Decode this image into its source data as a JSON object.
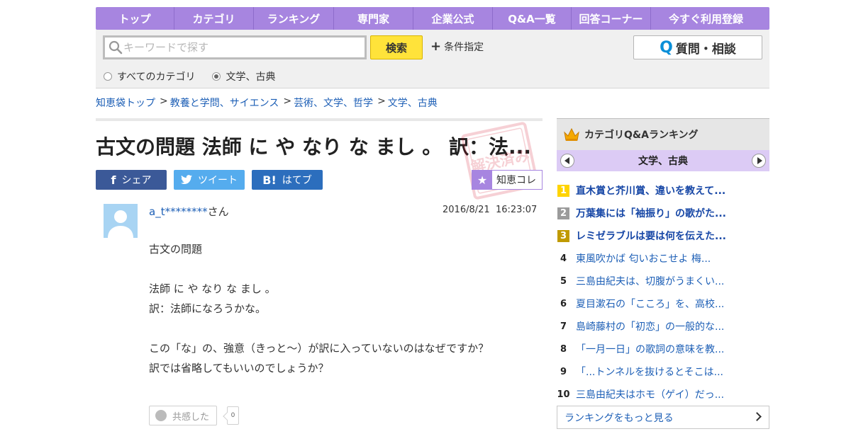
{
  "nav": {
    "items": [
      {
        "label": "トップ",
        "width": 111
      },
      {
        "label": "カテゴリ",
        "width": 112
      },
      {
        "label": "ランキング",
        "width": 113
      },
      {
        "label": "専門家",
        "width": 112
      },
      {
        "label": "企業公式",
        "width": 112
      },
      {
        "label": "Q&A一覧",
        "width": 111
      },
      {
        "label": "回答コーナー",
        "width": 112
      },
      {
        "label": "今すぐ利用登録",
        "width": 155
      }
    ]
  },
  "search": {
    "placeholder": "キーワードで探す",
    "button_label": "検索",
    "condition_label": "条件指定",
    "ask_label": "質問・相談",
    "ask_q": "Q",
    "radio_all": "すべてのカテゴリ",
    "radio_cat": "文学、古典",
    "selected": "radio_cat"
  },
  "breadcrumb": {
    "items": [
      "知恵袋トップ",
      "教養と学問、サイエンス",
      "芸術、文学、哲学",
      "文学、古典"
    ],
    "separator": ">"
  },
  "question": {
    "title": "古文の問題 法師 に や なり な まし 。 訳：法...",
    "stamp_text": "解決済み",
    "share_fb": "シェア",
    "share_tw": "ツイート",
    "share_hb": "はてブ",
    "share_fb_icon": "f",
    "share_hb_icon": "B!",
    "collect_label": "知恵コレ",
    "user_id": "a_t********",
    "user_suffix": "さん",
    "date": "2016/8/21",
    "time": "16:23:07",
    "body_lines": [
      "古文の問題",
      "",
      "法師 に や なり な まし 。",
      "訳：法師になろうかな。",
      "",
      "この「な」の、強意（きっと〜）が訳に入っていないのはなぜですか？",
      "訳では省略してもいいのでしょうか？"
    ],
    "empathy_label": "共感した",
    "empathy_count": "0"
  },
  "ranking": {
    "header": "カテゴリQ&Aランキング",
    "category": "文学、古典",
    "items": [
      {
        "rank": "1",
        "text": "直木賞と芥川賞、違いを教えて...",
        "style": "gold"
      },
      {
        "rank": "2",
        "text": "万葉集には「袖振り」の歌がた...",
        "style": "silver"
      },
      {
        "rank": "3",
        "text": "レミゼラブルは要は何を伝えた...",
        "style": "bronze"
      },
      {
        "rank": "4",
        "text": "東風吹かば 匂いおこせよ 梅...",
        "style": "plain"
      },
      {
        "rank": "5",
        "text": "三島由紀夫は、切腹がうまくい...",
        "style": "plain"
      },
      {
        "rank": "6",
        "text": "夏目漱石の「こころ」を、高校...",
        "style": "plain"
      },
      {
        "rank": "7",
        "text": "島崎藤村の「初恋」の一般的な...",
        "style": "plain"
      },
      {
        "rank": "8",
        "text": "「一月一日」の歌詞の意味を教...",
        "style": "plain"
      },
      {
        "rank": "9",
        "text": "「...トンネルを抜けるとそこは...",
        "style": "plain"
      },
      {
        "rank": "10",
        "text": "三島由紀夫はホモ（ゲイ）だっ...",
        "style": "plain"
      }
    ],
    "more_label": "ランキングをもっと見る"
  },
  "colors": {
    "nav_bg": "#a785e0",
    "accent_purple": "#a785e0",
    "search_button": "#ffe33a",
    "link_blue": "#1d5fb6",
    "facebook": "#3b5998",
    "twitter": "#55acee",
    "hatena": "#2c6ebd"
  },
  "icons": {
    "search": "magnifier-icon",
    "plus": "plus-icon",
    "crown": "crown-icon",
    "star": "star-icon",
    "avatar": "user-silhouette-icon"
  }
}
